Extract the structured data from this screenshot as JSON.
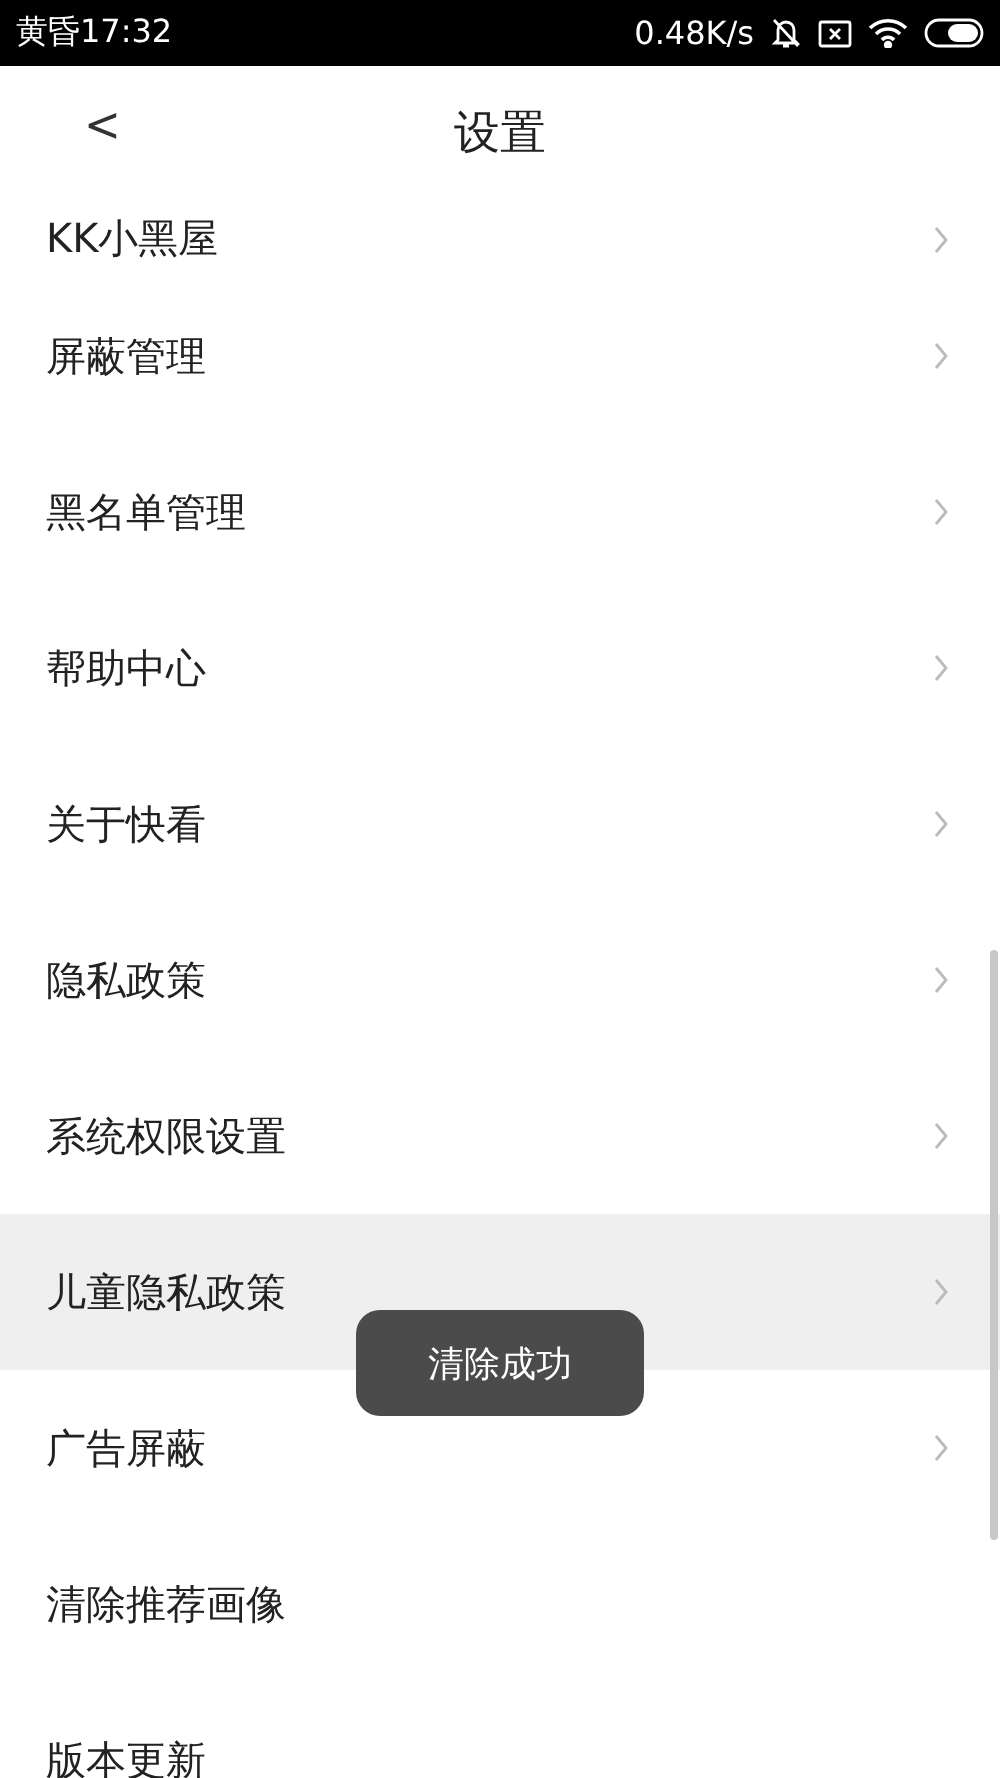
{
  "status_bar": {
    "time": "黄昏17:32",
    "speed": "0.48K/s"
  },
  "header": {
    "back": "<",
    "title": "设置"
  },
  "items": [
    {
      "label": "KK小黑屋",
      "has_arrow": true,
      "selected": false
    },
    {
      "label": "屏蔽管理",
      "has_arrow": true,
      "selected": false
    },
    {
      "label": "黑名单管理",
      "has_arrow": true,
      "selected": false
    },
    {
      "label": "帮助中心",
      "has_arrow": true,
      "selected": false
    },
    {
      "label": "关于快看",
      "has_arrow": true,
      "selected": false
    },
    {
      "label": "隐私政策",
      "has_arrow": true,
      "selected": false
    },
    {
      "label": "系统权限设置",
      "has_arrow": true,
      "selected": false
    },
    {
      "label": "儿童隐私政策",
      "has_arrow": true,
      "selected": true
    },
    {
      "label": "广告屏蔽",
      "has_arrow": true,
      "selected": false
    },
    {
      "label": "清除推荐画像",
      "has_arrow": false,
      "selected": false
    },
    {
      "label": "版本更新",
      "has_arrow": false,
      "selected": false
    }
  ],
  "toast": {
    "text": "清除成功"
  }
}
